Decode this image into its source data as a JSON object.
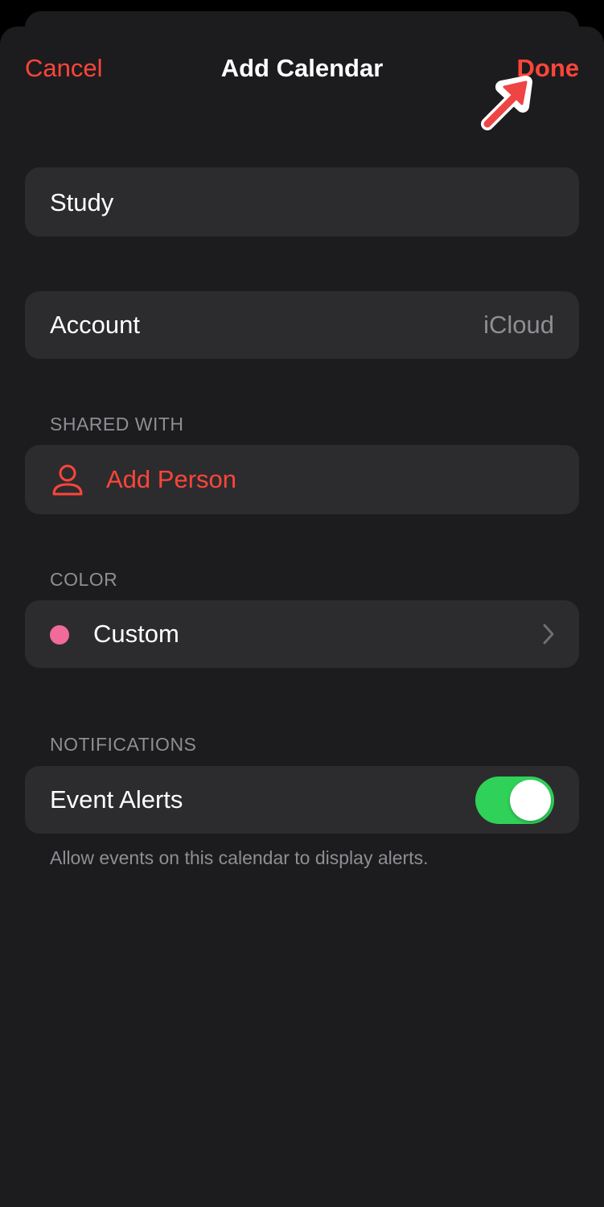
{
  "nav": {
    "cancel_label": "Cancel",
    "title": "Add Calendar",
    "done_label": "Done"
  },
  "calendar_name": {
    "value": "Study"
  },
  "account": {
    "label": "Account",
    "value": "iCloud"
  },
  "shared_with": {
    "header": "SHARED WITH",
    "add_person_label": "Add Person",
    "icon": "person-icon"
  },
  "color": {
    "header": "COLOR",
    "label": "Custom",
    "swatch": "#f06a9a",
    "icon": "chevron-right-icon"
  },
  "notifications": {
    "header": "NOTIFICATIONS",
    "event_alerts_label": "Event Alerts",
    "event_alerts_on": true,
    "footer": "Allow events on this calendar to display alerts."
  },
  "colors": {
    "accent": "#ff453a",
    "toggle_on": "#30d158",
    "background": "#1c1c1e",
    "cell": "#2c2c2e",
    "secondary_text": "#8e8e93"
  },
  "annotation": {
    "icon": "red-arrow-icon"
  }
}
